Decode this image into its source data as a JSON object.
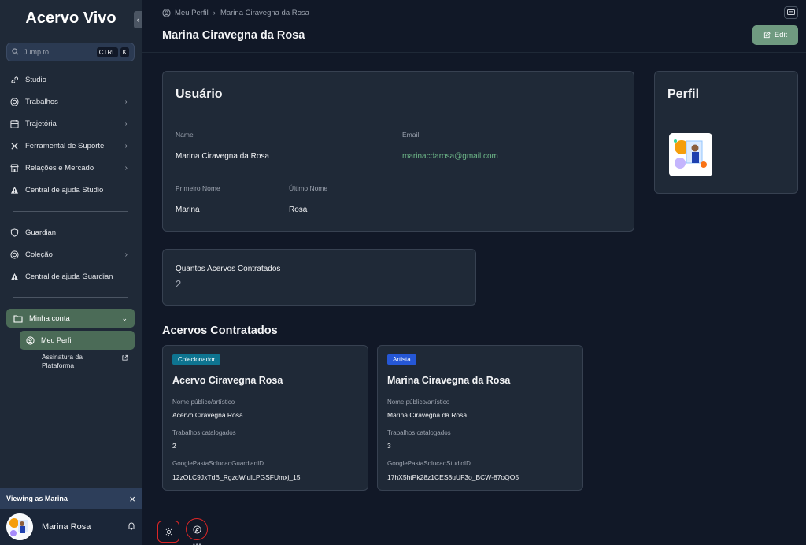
{
  "brand": "Acervo Vivo",
  "search": {
    "placeholder": "Jump to...",
    "kbd_ctrl": "CTRL",
    "kbd_k": "K"
  },
  "sidebar": {
    "items": [
      {
        "label": "Studio",
        "icon": "link-icon",
        "has_chevron": false
      },
      {
        "label": "Trabalhos",
        "icon": "target-icon",
        "has_chevron": true
      },
      {
        "label": "Trajetória",
        "icon": "calendar-icon",
        "has_chevron": true
      },
      {
        "label": "Ferramental de Suporte",
        "icon": "tools-icon",
        "has_chevron": true
      },
      {
        "label": "Relações e Mercado",
        "icon": "store-icon",
        "has_chevron": true
      },
      {
        "label": "Central de ajuda Studio",
        "icon": "warning-icon",
        "has_chevron": false
      },
      {
        "label": "Guardian",
        "icon": "shield-icon",
        "has_chevron": false
      },
      {
        "label": "Coleção",
        "icon": "target-icon",
        "has_chevron": true
      },
      {
        "label": "Central de ajuda Guardian",
        "icon": "warning-icon",
        "has_chevron": false
      }
    ],
    "minha_conta": "Minha conta",
    "meu_perfil": "Meu Perfil",
    "assinatura_line1": "Assinatura da",
    "assinatura_line2": "Plataforma"
  },
  "viewing": {
    "label": "Viewing as Marina",
    "close": "×"
  },
  "user": {
    "name": "Marina Rosa"
  },
  "breadcrumb": {
    "root": "Meu Perfil",
    "current": "Marina Ciravegna da Rosa"
  },
  "header": {
    "title": "Marina Ciravegna da Rosa",
    "edit_label": "Edit"
  },
  "usuario": {
    "title": "Usuário",
    "name_label": "Name",
    "name_value": "Marina Ciravegna da Rosa",
    "email_label": "Email",
    "email_value": "marinacdarosa@gmail.com",
    "first_label": "Primeiro Nome",
    "first_value": "Marina",
    "last_label": "Último Nome",
    "last_value": "Rosa"
  },
  "perfil": {
    "title": "Perfil"
  },
  "contratados_count": {
    "label": "Quantos Acervos Contratados",
    "value": "2"
  },
  "acervos": {
    "title": "Acervos Contratados",
    "cards": [
      {
        "badge": "Colecionador",
        "badge_color": "#0e7490",
        "title": "Acervo Ciravegna Rosa",
        "nome_label": "Nome público/artístico",
        "nome_value": "Acervo Ciravegna Rosa",
        "trab_label": "Trabalhos catalogados",
        "trab_value": "2",
        "id_label": "GooglePastaSolucaoGuardianID",
        "id_value": "12zOLC9JxTdB_RgzoWiulLPGSFUmxj_15"
      },
      {
        "badge": "Artista",
        "badge_color": "#2557d6",
        "title": "Marina Ciravegna da Rosa",
        "nome_label": "Nome público/artístico",
        "nome_value": "Marina Ciravegna da Rosa",
        "trab_label": "Trabalhos catalogados",
        "trab_value": "3",
        "id_label": "GooglePastaSolucaoStudioID",
        "id_value": "17hX5htPk28z1CES8uUF3o_BCW-87oQO5"
      }
    ]
  },
  "colors": {
    "accent_green": "#4b6b57",
    "edit_green": "#6f9a80",
    "email_green": "#6fba8a",
    "bg": "#111827",
    "card": "#1f2937"
  }
}
